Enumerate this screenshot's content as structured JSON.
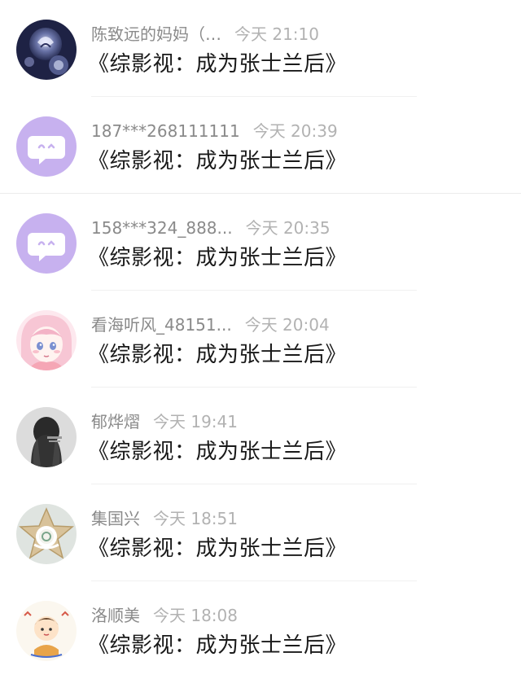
{
  "comments": [
    {
      "name": "陈致远的妈妈（…",
      "time": "今天 21:10",
      "title": "《综影视：成为张士兰后》",
      "avatar": "blue-rose-avatar"
    },
    {
      "name": "187***268111111",
      "time": "今天 20:39",
      "title": "《综影视：成为张士兰后》",
      "avatar": "default-chat-bubble-avatar"
    },
    {
      "name": "158***324_888...",
      "time": "今天 20:35",
      "title": "《综影视：成为张士兰后》",
      "avatar": "default-chat-bubble-avatar"
    },
    {
      "name": "看海听风_48151...",
      "time": "今天 20:04",
      "title": "《综影视：成为张士兰后》",
      "avatar": "anime-girl-avatar"
    },
    {
      "name": "郁烨熠",
      "time": "今天 19:41",
      "title": "《综影视：成为张士兰后》",
      "avatar": "dark-hair-portrait-avatar"
    },
    {
      "name": "集国兴",
      "time": "今天 18:51",
      "title": "《综影视：成为张士兰后》",
      "avatar": "star-cake-avatar"
    },
    {
      "name": "洛顺美",
      "time": "今天 18:08",
      "title": "《综影视：成为张士兰后》",
      "avatar": "cartoon-boy-avatar"
    }
  ],
  "colors": {
    "default_avatar_bg": "#c7b1ef",
    "name_text": "#8a8a8a",
    "time_text": "#b2b2b2",
    "title_text": "#1a1a1a"
  }
}
